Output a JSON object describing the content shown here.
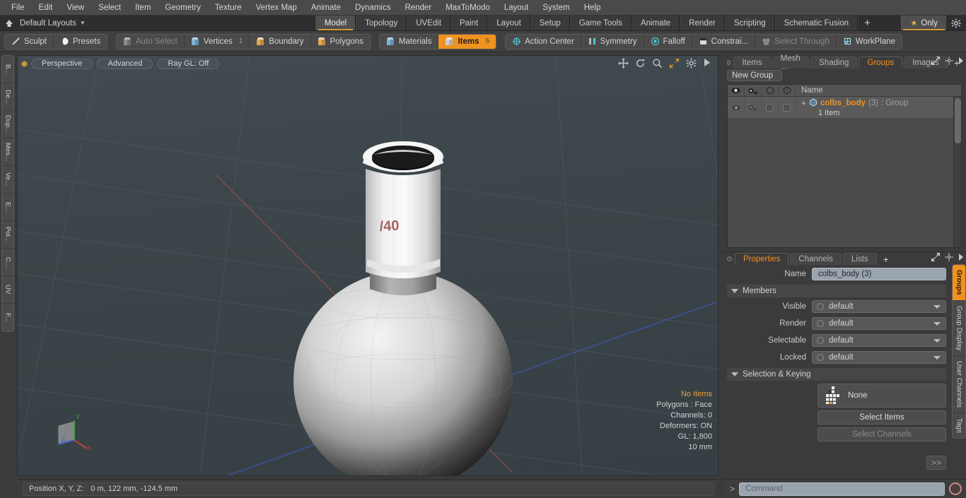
{
  "app": {
    "menu": [
      "File",
      "Edit",
      "View",
      "Select",
      "Item",
      "Geometry",
      "Texture",
      "Vertex Map",
      "Animate",
      "Dynamics",
      "Render",
      "MaxToModo",
      "Layout",
      "System",
      "Help"
    ],
    "accent": "#f0921f",
    "layout_preset": "Default Layouts",
    "layout_tabs": [
      {
        "label": "Model",
        "active": true
      },
      {
        "label": "Topology",
        "active": false
      },
      {
        "label": "UVEdit",
        "active": false
      },
      {
        "label": "Paint",
        "active": false
      },
      {
        "label": "Layout",
        "active": false
      },
      {
        "label": "Setup",
        "active": false
      },
      {
        "label": "Game Tools",
        "active": false
      },
      {
        "label": "Animate",
        "active": false
      },
      {
        "label": "Render",
        "active": false
      },
      {
        "label": "Scripting",
        "active": false
      },
      {
        "label": "Schematic Fusion",
        "active": false
      }
    ],
    "add_tab_label": "+",
    "only_label": "Only",
    "home_icon": "home-icon",
    "gear_icon": "gear-icon"
  },
  "modebar": {
    "left_group": [
      {
        "label": "Sculpt",
        "icon": "pen-icon",
        "state": "normal"
      },
      {
        "label": "Presets",
        "icon": "sphere-icon",
        "state": "normal"
      }
    ],
    "select_group": [
      {
        "label": "Auto Select",
        "icon": "cube-gray-icon",
        "badge": "",
        "state": "disabled"
      },
      {
        "label": "Vertices",
        "icon": "cube-blue-icon",
        "badge": "1",
        "state": "normal"
      },
      {
        "label": "Boundary",
        "icon": "cube-orange-icon",
        "badge": "",
        "state": "normal"
      },
      {
        "label": "Polygons",
        "icon": "cube-orange-icon",
        "badge": "",
        "state": "normal"
      }
    ],
    "items_group": [
      {
        "label": "Materials",
        "icon": "cube-blue-icon",
        "badge": "",
        "state": "normal"
      },
      {
        "label": "Items",
        "icon": "cube-white-icon",
        "badge": "5",
        "state": "active"
      }
    ],
    "right_group": [
      {
        "label": "Action Center",
        "icon": "target-icon",
        "state": "normal"
      },
      {
        "label": "Symmetry",
        "icon": "symmetry-icon",
        "state": "normal"
      },
      {
        "label": "Falloff",
        "icon": "falloff-icon",
        "state": "normal"
      },
      {
        "label": "Constrai...",
        "icon": "constraint-icon",
        "state": "normal"
      },
      {
        "label": "Select Through",
        "icon": "select-through-icon",
        "state": "disabled"
      },
      {
        "label": "WorkPlane",
        "icon": "workplane-icon",
        "state": "normal"
      }
    ]
  },
  "left_toolbar": {
    "tabs": [
      "B...",
      "De...",
      "Dup...",
      "Mes...",
      "Ve...",
      "E...",
      "Pol...",
      "C...",
      "UV",
      "F..."
    ]
  },
  "viewport": {
    "view_name": "Perspective",
    "shading": "Advanced",
    "raygl": "Ray GL: Off",
    "icons": [
      "move-icon",
      "rotate-icon",
      "zoom-icon",
      "fit-icon",
      "gear-icon",
      "play-icon"
    ],
    "stats": {
      "items": "No Items",
      "polygons": "Polygons : Face",
      "channels": "Channels: 0",
      "deformers": "Deformers: ON",
      "gl": "GL: 1,800",
      "scale": "10 mm"
    },
    "axis": {
      "x": "X",
      "y": "Y",
      "z": "Z",
      "x_color": "#c04040",
      "y_color": "#3fa43f",
      "z_color": "#4060c0"
    },
    "model_label": "/40"
  },
  "statusbar": {
    "position_label": "Position X, Y, Z:",
    "position_value": "0 m, 122 mm, -124.5 mm"
  },
  "command": {
    "caret": ">",
    "placeholder": "Command",
    "value": ""
  },
  "right_panel": {
    "tabs": [
      {
        "label": "Items",
        "active": false
      },
      {
        "label": "Mesh ...",
        "active": false
      },
      {
        "label": "Shading",
        "active": false
      },
      {
        "label": "Groups",
        "active": true
      },
      {
        "label": "Images",
        "active": false
      }
    ],
    "add_tab": "+",
    "new_group_button": "New Group",
    "list_columns": [
      "eye-icon",
      "render-icon",
      "select-icon",
      "lock-icon"
    ],
    "name_column": "Name",
    "rows": [
      {
        "expand": "+",
        "name": "colbs_body",
        "count": "(3)",
        "type": ": Group",
        "sub": "1 Item",
        "selected": true
      }
    ]
  },
  "properties": {
    "tabs": [
      {
        "label": "Properties",
        "active": true
      },
      {
        "label": "Channels",
        "active": false
      },
      {
        "label": "Lists",
        "active": false
      }
    ],
    "add_tab": "+",
    "name_label": "Name",
    "name_value": "colbs_body (3)",
    "members_section": "Members",
    "fields": [
      {
        "label": "Visible",
        "value": "default"
      },
      {
        "label": "Render",
        "value": "default"
      },
      {
        "label": "Selectable",
        "value": "default"
      },
      {
        "label": "Locked",
        "value": "default"
      }
    ],
    "selection_section": "Selection & Keying",
    "key_value": "None",
    "select_items_button": "Select Items",
    "select_channels_button": "Select Channels",
    "more_button": ">>"
  },
  "right_vtabs": [
    {
      "label": "Groups",
      "active": true
    },
    {
      "label": "Group Display",
      "active": false
    },
    {
      "label": "User Channels",
      "active": false
    },
    {
      "label": "Tags",
      "active": false
    }
  ]
}
